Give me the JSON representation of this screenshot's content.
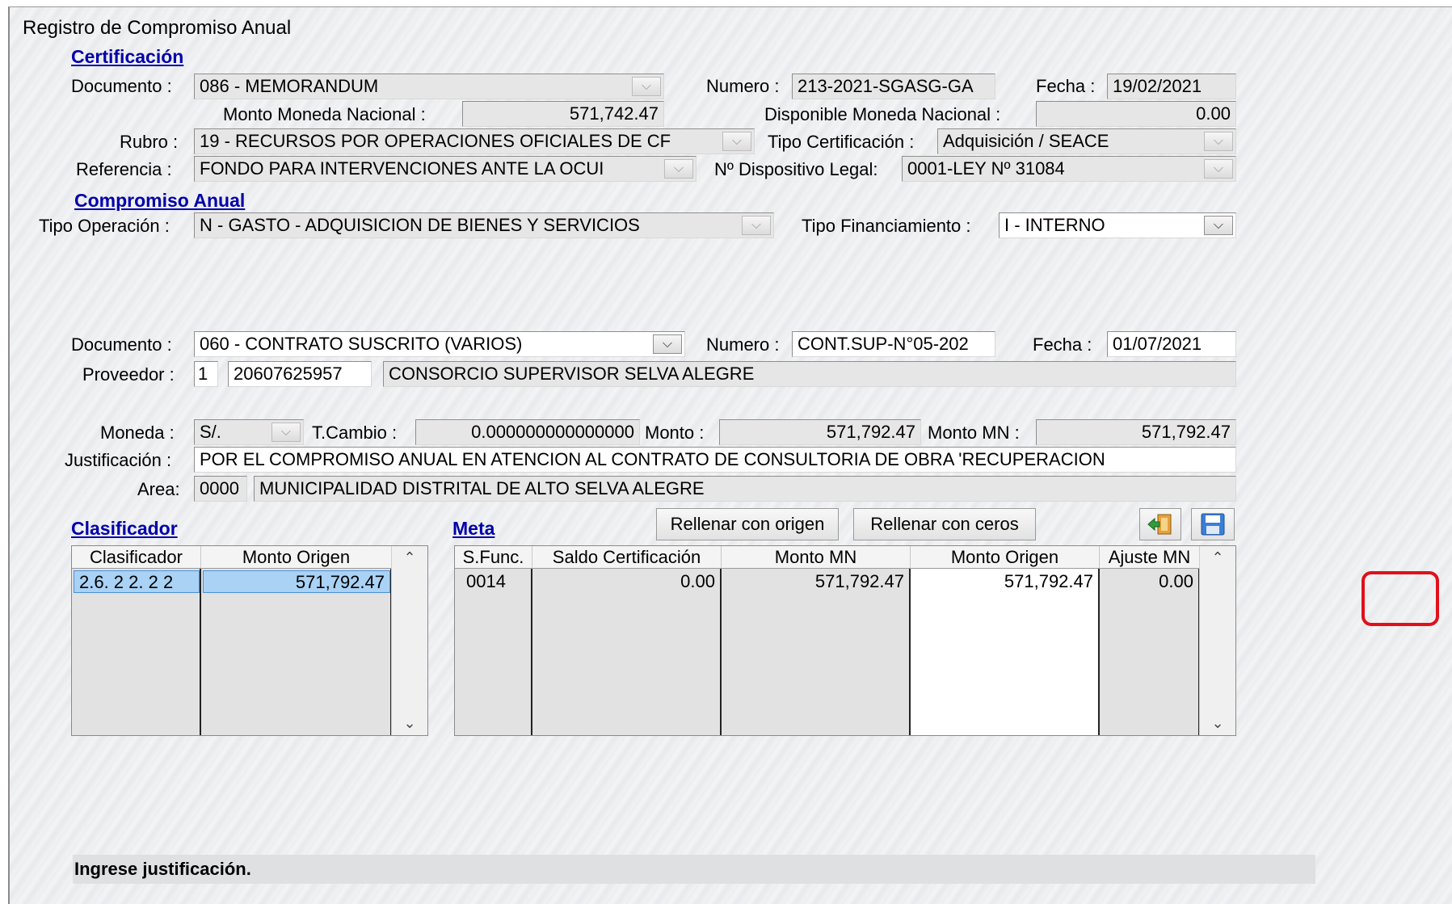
{
  "window": {
    "title": "Registro de Compromiso Anual"
  },
  "certificacion": {
    "section_label": "Certificación",
    "documento_label": "Documento :",
    "documento_value": "086 - MEMORANDUM",
    "numero_label": "Numero :",
    "numero_value": "213-2021-SGASG-GA",
    "fecha_label": "Fecha :",
    "fecha_value": "19/02/2021",
    "monto_mn_label": "Monto Moneda Nacional :",
    "monto_mn_value": "571,742.47",
    "disponible_label": "Disponible Moneda Nacional :",
    "disponible_value": "0.00",
    "rubro_label": "Rubro :",
    "rubro_value": "19 - RECURSOS POR OPERACIONES OFICIALES DE CF",
    "tipo_cert_label": "Tipo Certificación :",
    "tipo_cert_value": "Adquisición / SEACE",
    "referencia_label": "Referencia :",
    "referencia_value": "FONDO PARA INTERVENCIONES ANTE LA OCUI",
    "dispositivo_label": "Nº Dispositivo Legal:",
    "dispositivo_value": "0001-LEY Nº 31084"
  },
  "compromiso": {
    "section_label": "Compromiso Anual",
    "tipo_operacion_label": "Tipo Operación :",
    "tipo_operacion_value": "N  - GASTO - ADQUISICION DE BIENES Y SERVICIOS",
    "tipo_financiamiento_label": "Tipo Financiamiento :",
    "tipo_financiamiento_value": "I - INTERNO",
    "documento_label": "Documento :",
    "documento_value": "060 - CONTRATO SUSCRITO (VARIOS)",
    "numero_label": "Numero :",
    "numero_value": "CONT.SUP-N°05-202",
    "fecha_label": "Fecha :",
    "fecha_value": "01/07/2021",
    "proveedor_label": "Proveedor :",
    "proveedor_tipo": "1",
    "proveedor_ruc": "20607625957",
    "proveedor_nombre": "CONSORCIO SUPERVISOR SELVA ALEGRE",
    "moneda_label": "Moneda :",
    "moneda_value": "S/.",
    "tcambio_label": "T.Cambio :",
    "tcambio_value": "0.000000000000000",
    "monto_label": "Monto :",
    "monto_value": "571,792.47",
    "monto_mn_label": "Monto MN :",
    "monto_mn_value": "571,792.47",
    "justificacion_label": "Justificación :",
    "justificacion_value": "POR EL COMPROMISO ANUAL EN ATENCION AL CONTRATO DE CONSULTORIA DE OBRA 'RECUPERACION",
    "area_label": "Area:",
    "area_code": "0000",
    "area_name": "MUNICIPALIDAD DISTRITAL DE ALTO SELVA ALEGRE"
  },
  "clasificador": {
    "section_label": "Clasificador",
    "headers": [
      "Clasificador",
      "Monto Origen"
    ],
    "rows": [
      [
        "2.6. 2 2. 2 2",
        "571,792.47"
      ]
    ]
  },
  "meta": {
    "section_label": "Meta",
    "headers": [
      "S.Func.",
      "Saldo Certificación",
      "Monto MN",
      "Monto Origen",
      "Ajuste MN"
    ],
    "rows": [
      [
        "0014",
        "0.00",
        "571,792.47",
        "571,792.47",
        "0.00"
      ]
    ]
  },
  "buttons": {
    "rellenar_origen": "Rellenar con origen",
    "rellenar_ceros": "Rellenar con ceros"
  },
  "status_message": "Ingrese justificación.",
  "icons": {
    "exit": "exit-door-icon",
    "save": "floppy-save-icon",
    "dropdown": "chevron-down-icon"
  },
  "colors": {
    "section": "#0000aa",
    "highlight": "#e0101a",
    "selection": "#a9d2f5"
  }
}
